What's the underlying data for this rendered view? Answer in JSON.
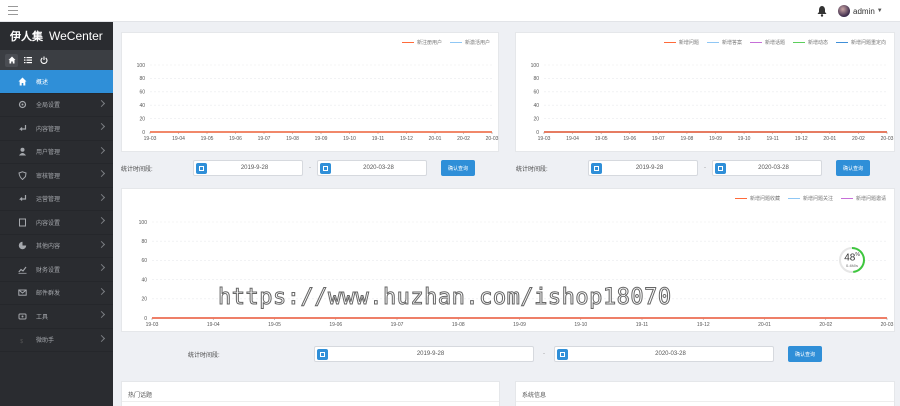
{
  "app": {
    "brand_cn": "伊人集",
    "brand_en": "WeCenter"
  },
  "topbar": {
    "username": "admin"
  },
  "sidebar": {
    "quick_icons": [
      "home-icon",
      "list-icon",
      "power-icon"
    ],
    "items": [
      {
        "label": "概述",
        "icon": "home-icon",
        "active": true
      },
      {
        "label": "全局设置",
        "icon": "gear-icon"
      },
      {
        "label": "内容管理",
        "icon": "reply-icon"
      },
      {
        "label": "用户管理",
        "icon": "user-icon"
      },
      {
        "label": "审核管理",
        "icon": "shield-icon"
      },
      {
        "label": "运营管理",
        "icon": "reply-icon"
      },
      {
        "label": "内容设置",
        "icon": "book-icon"
      },
      {
        "label": "其他内容",
        "icon": "pie-icon"
      },
      {
        "label": "财务设置",
        "icon": "chart-icon"
      },
      {
        "label": "邮件群发",
        "icon": "mail-icon"
      },
      {
        "label": "工具",
        "icon": "tool-icon"
      },
      {
        "label": "微助手",
        "icon": "dollar-icon"
      }
    ]
  },
  "filter": {
    "label": "统计时间段:",
    "start_short": "2019-9-28",
    "end_short": "2020-03-28",
    "start_long": "2019-9-28",
    "end_long": "2020-03-28",
    "separator": "-",
    "button": "确认查询"
  },
  "chart_data": [
    {
      "type": "line",
      "x": [
        "19-03",
        "19-04",
        "19-05",
        "19-06",
        "19-07",
        "19-08",
        "19-09",
        "19-10",
        "19-11",
        "19-12",
        "20-01",
        "20-02",
        "20-03"
      ],
      "ylim": [
        0,
        100
      ],
      "yticks": [
        0,
        20,
        40,
        60,
        80,
        100
      ],
      "legend_position": "top-right",
      "series": [
        {
          "name": "新注册用户",
          "color": "#ff6a3a",
          "values": [
            0,
            0,
            0,
            0,
            0,
            0,
            0,
            0,
            0,
            0,
            0,
            0,
            0
          ]
        },
        {
          "name": "新激活用户",
          "color": "#8fc7f5",
          "values": [
            0,
            0,
            0,
            0,
            0,
            0,
            0,
            0,
            0,
            0,
            0,
            0,
            0
          ]
        }
      ]
    },
    {
      "type": "line",
      "x": [
        "19-03",
        "19-04",
        "19-05",
        "19-06",
        "19-07",
        "19-08",
        "19-09",
        "19-10",
        "19-11",
        "19-12",
        "20-01",
        "20-02",
        "20-03"
      ],
      "ylim": [
        0,
        100
      ],
      "yticks": [
        0,
        20,
        40,
        60,
        80,
        100
      ],
      "legend_position": "top-right",
      "series": [
        {
          "name": "新增问题",
          "color": "#ff6a3a",
          "values": [
            0,
            0,
            0,
            0,
            0,
            0,
            0,
            0,
            0,
            0,
            0,
            0,
            0
          ]
        },
        {
          "name": "新增答案",
          "color": "#8fc7f5",
          "values": [
            0,
            0,
            0,
            0,
            0,
            0,
            0,
            0,
            0,
            0,
            0,
            0,
            0
          ]
        },
        {
          "name": "新增话题",
          "color": "#c66fd8",
          "values": [
            0,
            0,
            0,
            0,
            0,
            0,
            0,
            0,
            0,
            0,
            0,
            0,
            0
          ]
        },
        {
          "name": "新增动态",
          "color": "#5ccf5c",
          "values": [
            0,
            0,
            0,
            0,
            0,
            0,
            0,
            0,
            0,
            0,
            0,
            0,
            0
          ]
        },
        {
          "name": "新增问题重定向",
          "color": "#3f8fd8",
          "values": [
            0,
            0,
            0,
            0,
            0,
            0,
            0,
            0,
            0,
            0,
            0,
            0,
            0
          ]
        }
      ]
    },
    {
      "type": "line",
      "x": [
        "19-03",
        "19-04",
        "19-05",
        "19-06",
        "19-07",
        "19-08",
        "19-09",
        "19-10",
        "19-11",
        "19-12",
        "20-01",
        "20-02",
        "20-03"
      ],
      "ylim": [
        0,
        100
      ],
      "yticks": [
        0,
        20,
        40,
        60,
        80,
        100
      ],
      "legend_position": "top-right",
      "series": [
        {
          "name": "新增问题收藏",
          "color": "#ff6a3a",
          "values": [
            0,
            0,
            0,
            0,
            0,
            0,
            0,
            0,
            0,
            0,
            0,
            0,
            0
          ]
        },
        {
          "name": "新增问题关注",
          "color": "#8fc7f5",
          "values": [
            0,
            0,
            0,
            0,
            0,
            0,
            0,
            0,
            0,
            0,
            0,
            0,
            0
          ]
        },
        {
          "name": "新增问题邀请",
          "color": "#c66fd8",
          "values": [
            0,
            0,
            0,
            0,
            0,
            0,
            0,
            0,
            0,
            0,
            0,
            0,
            0
          ]
        }
      ]
    }
  ],
  "gauge": {
    "value": 48,
    "unit": "%",
    "sub": "0.4M/s",
    "color": "#3ec73e"
  },
  "watermark": "https://www.huzhan.com/ishop18070",
  "bottom": {
    "left_title": "热门话题",
    "right_title": "系统信息"
  }
}
